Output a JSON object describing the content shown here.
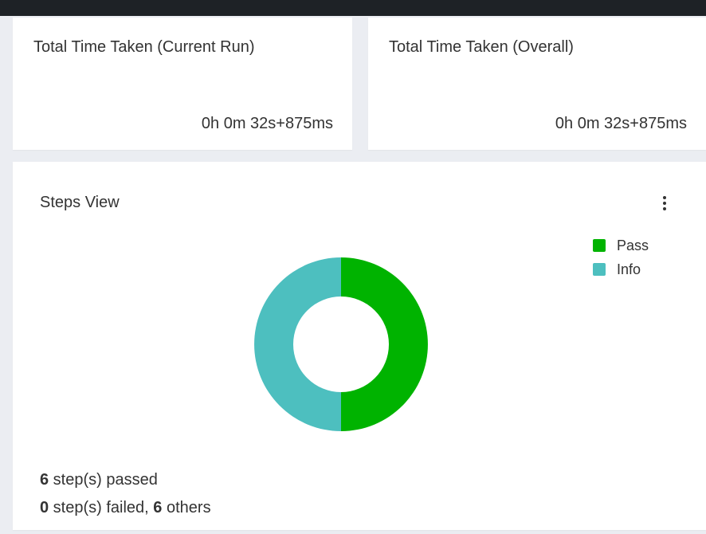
{
  "time_current": {
    "title": "Total Time Taken (Current Run)",
    "value": "0h 0m 32s+875ms"
  },
  "time_overall": {
    "title": "Total Time Taken (Overall)",
    "value": "0h 0m 32s+875ms"
  },
  "steps_view": {
    "title": "Steps View",
    "menu_icon": "more-vertical-icon",
    "summary": {
      "passed_count": "6",
      "passed_text": " step(s) passed",
      "failed_count": "0",
      "failed_text": " step(s) failed, ",
      "others_count": "6",
      "others_text": " others"
    }
  },
  "colors": {
    "pass": "#00b300",
    "info": "#4dbfbf",
    "topbar": "#1e2226"
  },
  "chart_data": {
    "type": "pie",
    "subtype": "donut",
    "categories": [
      "Pass",
      "Info"
    ],
    "values": [
      6,
      6
    ],
    "colors": [
      "#00b300",
      "#4dbfbf"
    ],
    "legend_position": "top-right"
  }
}
